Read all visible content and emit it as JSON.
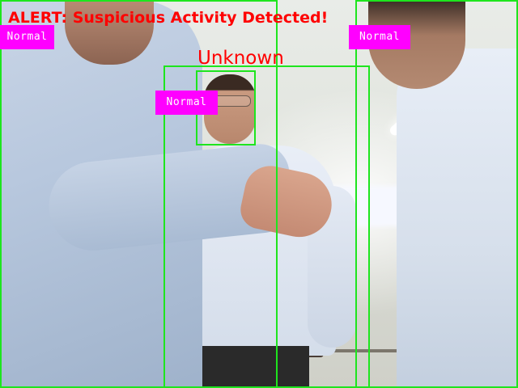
{
  "overlay": {
    "alert_text": "ALERT: Suspicious Activity Detected!",
    "face_label": "Unknown",
    "detections": [
      {
        "label": "Normal"
      },
      {
        "label": "Normal"
      },
      {
        "label": "Normal"
      }
    ]
  },
  "colors": {
    "box": "#1ee51e",
    "label_bg": "#ff00ff",
    "label_text": "#ffffff",
    "alert": "#ff0000"
  }
}
